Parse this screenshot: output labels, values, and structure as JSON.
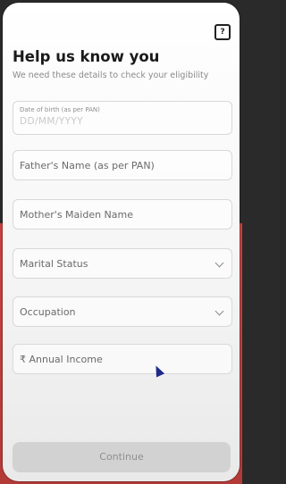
{
  "header": {
    "help_icon": "?",
    "title": "Help us know you",
    "subtitle": "We need these details to check your eligibility"
  },
  "form": {
    "dob_label": "Date of birth (as per PAN)",
    "dob_placeholder": "DD/MM/YYYY",
    "father_label": "Father's Name (as per PAN)",
    "mother_label": "Mother's Maiden Name",
    "marital_label": "Marital Status",
    "occupation_label": "Occupation",
    "income_label": "₹ Annual Income"
  },
  "actions": {
    "continue_label": "Continue"
  }
}
